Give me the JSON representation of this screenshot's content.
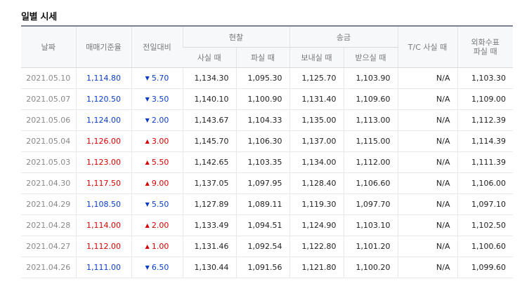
{
  "title": "일별 시세",
  "headers": {
    "date": "날짜",
    "base_rate": "매매기준율",
    "change": "전일대비",
    "cash": "현찰",
    "cash_buy": "사실 때",
    "cash_sell": "파실 때",
    "transfer": "송금",
    "transfer_send": "보내실 때",
    "transfer_receive": "받으실 때",
    "tc_buy": "T/C 사실 때",
    "foreign_check_line1": "외화수표",
    "foreign_check_line2": "파실 때"
  },
  "colors": {
    "up": "#d60000",
    "down": "#0a3cc8"
  },
  "rows": [
    {
      "date": "2021.05.10",
      "base": "1,114.80",
      "dir": "down",
      "arrow": "▼",
      "change": "5.70",
      "cash_buy": "1,134.30",
      "cash_sell": "1,095.30",
      "send": "1,125.70",
      "receive": "1,103.90",
      "tc": "N/A",
      "check": "1,103.30"
    },
    {
      "date": "2021.05.07",
      "base": "1,120.50",
      "dir": "down",
      "arrow": "▼",
      "change": "3.50",
      "cash_buy": "1,140.10",
      "cash_sell": "1,100.90",
      "send": "1,131.40",
      "receive": "1,109.60",
      "tc": "N/A",
      "check": "1,109.00"
    },
    {
      "date": "2021.05.06",
      "base": "1,124.00",
      "dir": "down",
      "arrow": "▼",
      "change": "2.00",
      "cash_buy": "1,143.67",
      "cash_sell": "1,104.33",
      "send": "1,135.00",
      "receive": "1,113.00",
      "tc": "N/A",
      "check": "1,112.39"
    },
    {
      "date": "2021.05.04",
      "base": "1,126.00",
      "dir": "up",
      "arrow": "▲",
      "change": "3.00",
      "cash_buy": "1,145.70",
      "cash_sell": "1,106.30",
      "send": "1,137.00",
      "receive": "1,115.00",
      "tc": "N/A",
      "check": "1,114.39"
    },
    {
      "date": "2021.05.03",
      "base": "1,123.00",
      "dir": "up",
      "arrow": "▲",
      "change": "5.50",
      "cash_buy": "1,142.65",
      "cash_sell": "1,103.35",
      "send": "1,134.00",
      "receive": "1,112.00",
      "tc": "N/A",
      "check": "1,111.39"
    },
    {
      "date": "2021.04.30",
      "base": "1,117.50",
      "dir": "up",
      "arrow": "▲",
      "change": "9.00",
      "cash_buy": "1,137.05",
      "cash_sell": "1,097.95",
      "send": "1,128.40",
      "receive": "1,106.60",
      "tc": "N/A",
      "check": "1,106.00"
    },
    {
      "date": "2021.04.29",
      "base": "1,108.50",
      "dir": "down",
      "arrow": "▼",
      "change": "5.50",
      "cash_buy": "1,127.89",
      "cash_sell": "1,089.11",
      "send": "1,119.30",
      "receive": "1,097.70",
      "tc": "N/A",
      "check": "1,097.10"
    },
    {
      "date": "2021.04.28",
      "base": "1,114.00",
      "dir": "up",
      "arrow": "▲",
      "change": "2.00",
      "cash_buy": "1,133.49",
      "cash_sell": "1,094.51",
      "send": "1,124.90",
      "receive": "1,103.10",
      "tc": "N/A",
      "check": "1,102.50"
    },
    {
      "date": "2021.04.27",
      "base": "1,112.00",
      "dir": "up",
      "arrow": "▲",
      "change": "1.00",
      "cash_buy": "1,131.46",
      "cash_sell": "1,092.54",
      "send": "1,122.80",
      "receive": "1,101.20",
      "tc": "N/A",
      "check": "1,100.60"
    },
    {
      "date": "2021.04.26",
      "base": "1,111.00",
      "dir": "down",
      "arrow": "▼",
      "change": "6.50",
      "cash_buy": "1,130.44",
      "cash_sell": "1,091.56",
      "send": "1,121.80",
      "receive": "1,100.20",
      "tc": "N/A",
      "check": "1,099.60"
    }
  ]
}
